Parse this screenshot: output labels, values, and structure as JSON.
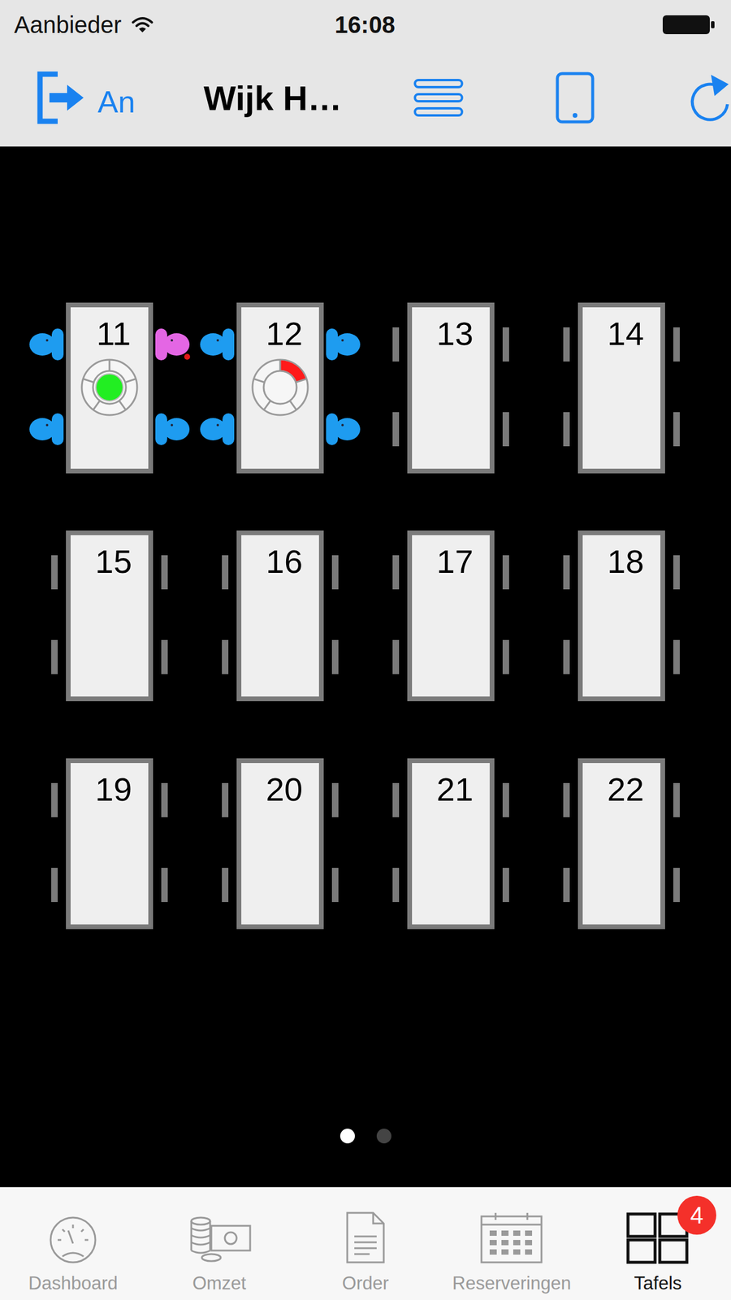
{
  "status_bar": {
    "carrier": "Aanbieder",
    "time": "16:08"
  },
  "nav_bar": {
    "user": "An",
    "title": "Wijk H…"
  },
  "tables": [
    {
      "number": "11",
      "left": [
        {
          "occupied": true,
          "color": "#1e9cf0",
          "alert": false
        },
        {
          "occupied": true,
          "color": "#1e9cf0",
          "alert": false
        }
      ],
      "right": [
        {
          "occupied": true,
          "color": "#e466e4",
          "alert": true
        },
        {
          "occupied": true,
          "color": "#1e9cf0",
          "alert": false
        }
      ],
      "indicator": {
        "kind": "ready",
        "color": "#22ee22"
      }
    },
    {
      "number": "12",
      "left": [
        {
          "occupied": true,
          "color": "#1e9cf0",
          "alert": false
        },
        {
          "occupied": true,
          "color": "#1e9cf0",
          "alert": false
        }
      ],
      "right": [
        {
          "occupied": true,
          "color": "#1e9cf0",
          "alert": false
        },
        {
          "occupied": true,
          "color": "#1e9cf0",
          "alert": false
        }
      ],
      "indicator": {
        "kind": "progress",
        "level": 0.2,
        "color": "#ff1a1a"
      }
    },
    {
      "number": "13",
      "left": [
        {
          "occupied": false
        },
        {
          "occupied": false
        }
      ],
      "right": [
        {
          "occupied": false
        },
        {
          "occupied": false
        }
      ],
      "indicator": null
    },
    {
      "number": "14",
      "left": [
        {
          "occupied": false
        },
        {
          "occupied": false
        }
      ],
      "right": [
        {
          "occupied": false
        },
        {
          "occupied": false
        }
      ],
      "indicator": null
    },
    {
      "number": "15",
      "left": [
        {
          "occupied": false
        },
        {
          "occupied": false
        }
      ],
      "right": [
        {
          "occupied": false
        },
        {
          "occupied": false
        }
      ],
      "indicator": null
    },
    {
      "number": "16",
      "left": [
        {
          "occupied": false
        },
        {
          "occupied": false
        }
      ],
      "right": [
        {
          "occupied": false
        },
        {
          "occupied": false
        }
      ],
      "indicator": null
    },
    {
      "number": "17",
      "left": [
        {
          "occupied": false
        },
        {
          "occupied": false
        }
      ],
      "right": [
        {
          "occupied": false
        },
        {
          "occupied": false
        }
      ],
      "indicator": null
    },
    {
      "number": "18",
      "left": [
        {
          "occupied": false
        },
        {
          "occupied": false
        }
      ],
      "right": [
        {
          "occupied": false
        },
        {
          "occupied": false
        }
      ],
      "indicator": null
    },
    {
      "number": "19",
      "left": [
        {
          "occupied": false
        },
        {
          "occupied": false
        }
      ],
      "right": [
        {
          "occupied": false
        },
        {
          "occupied": false
        }
      ],
      "indicator": null
    },
    {
      "number": "20",
      "left": [
        {
          "occupied": false
        },
        {
          "occupied": false
        }
      ],
      "right": [
        {
          "occupied": false
        },
        {
          "occupied": false
        }
      ],
      "indicator": null
    },
    {
      "number": "21",
      "left": [
        {
          "occupied": false
        },
        {
          "occupied": false
        }
      ],
      "right": [
        {
          "occupied": false
        },
        {
          "occupied": false
        }
      ],
      "indicator": null
    },
    {
      "number": "22",
      "left": [
        {
          "occupied": false
        },
        {
          "occupied": false
        }
      ],
      "right": [
        {
          "occupied": false
        },
        {
          "occupied": false
        }
      ],
      "indicator": null
    }
  ],
  "pages": [
    {
      "selected": true
    },
    {
      "selected": false
    }
  ],
  "tab_bar": [
    {
      "label": "Dashboard",
      "selected": false
    },
    {
      "label": "Omzet",
      "selected": false
    },
    {
      "label": "Order",
      "selected": false
    },
    {
      "label": "Reserveringen",
      "selected": false
    },
    {
      "label": "Tafels",
      "selected": true,
      "badge": "4"
    }
  ]
}
